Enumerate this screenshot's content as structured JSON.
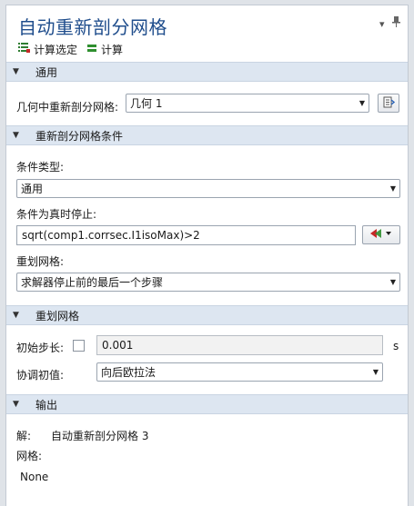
{
  "window": {
    "title": "自动重新剖分网格",
    "menu_icon": "dropdown-arrow-icon",
    "pin_icon": "pin-icon"
  },
  "toolbar": {
    "select_label": "计算选定",
    "compute_label": "计算"
  },
  "sections": {
    "general": {
      "label": "通用",
      "geometry_label": "几何中重新剖分网格:",
      "geometry_value": "几何 1"
    },
    "conditions": {
      "label": "重新剖分网格条件",
      "type_label": "条件类型:",
      "type_value": "通用",
      "stop_label": "条件为真时停止:",
      "stop_value": "sqrt(comp1.corrsec.I1isoMax)>2",
      "remesh_label": "重划网格:",
      "remesh_value": "求解器停止前的最后一个步骤"
    },
    "remesh": {
      "label": "重划网格",
      "initial_step_label": "初始步长:",
      "initial_step_checked": false,
      "initial_step_value": "0.001",
      "initial_step_unit": "s",
      "consistent_label": "协调初值:",
      "consistent_value": "向后欧拉法"
    },
    "output": {
      "label": "输出",
      "solution_label": "解:",
      "solution_value": "自动重新剖分网格 3",
      "mesh_label": "网格:",
      "mesh_value": "None"
    }
  },
  "colors": {
    "title": "#1f4d8c",
    "section_bg": "#dde6f1",
    "panel_bg": "#ffffff"
  }
}
